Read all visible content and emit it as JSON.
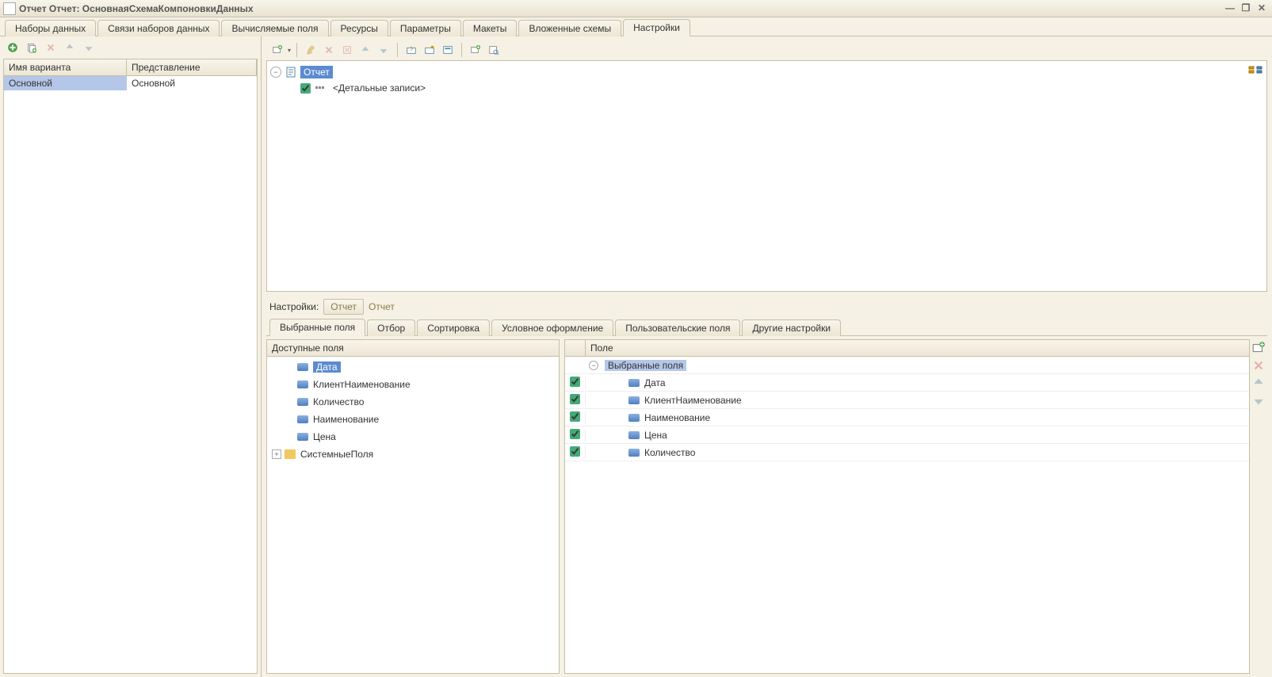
{
  "title": "Отчет Отчет: ОсновнаяСхемаКомпоновкиДанных",
  "main_tabs": [
    {
      "label": "Наборы данных"
    },
    {
      "label": "Связи наборов данных"
    },
    {
      "label": "Вычисляемые поля"
    },
    {
      "label": "Ресурсы"
    },
    {
      "label": "Параметры"
    },
    {
      "label": "Макеты"
    },
    {
      "label": "Вложенные схемы"
    },
    {
      "label": "Настройки"
    }
  ],
  "left_grid": {
    "headers": {
      "name": "Имя варианта",
      "repr": "Представление"
    },
    "rows": [
      {
        "name": "Основной",
        "repr": "Основной"
      }
    ]
  },
  "top_tree": {
    "root": "Отчет",
    "child": "<Детальные записи>"
  },
  "breadcrumb": {
    "label": "Настройки:",
    "box": "Отчет",
    "text": "Отчет"
  },
  "sub_tabs": [
    {
      "label": "Выбранные поля"
    },
    {
      "label": "Отбор"
    },
    {
      "label": "Сортировка"
    },
    {
      "label": "Условное оформление"
    },
    {
      "label": "Пользовательские поля"
    },
    {
      "label": "Другие настройки"
    }
  ],
  "avail": {
    "header": "Доступные поля",
    "fields": [
      "Дата",
      "КлиентНаименование",
      "Количество",
      "Наименование",
      "Цена"
    ],
    "system": "СистемныеПоля"
  },
  "selected": {
    "header": "Поле",
    "root": "Выбранные поля",
    "items": [
      "Дата",
      "КлиентНаименование",
      "Наименование",
      "Цена",
      "Количество"
    ]
  }
}
